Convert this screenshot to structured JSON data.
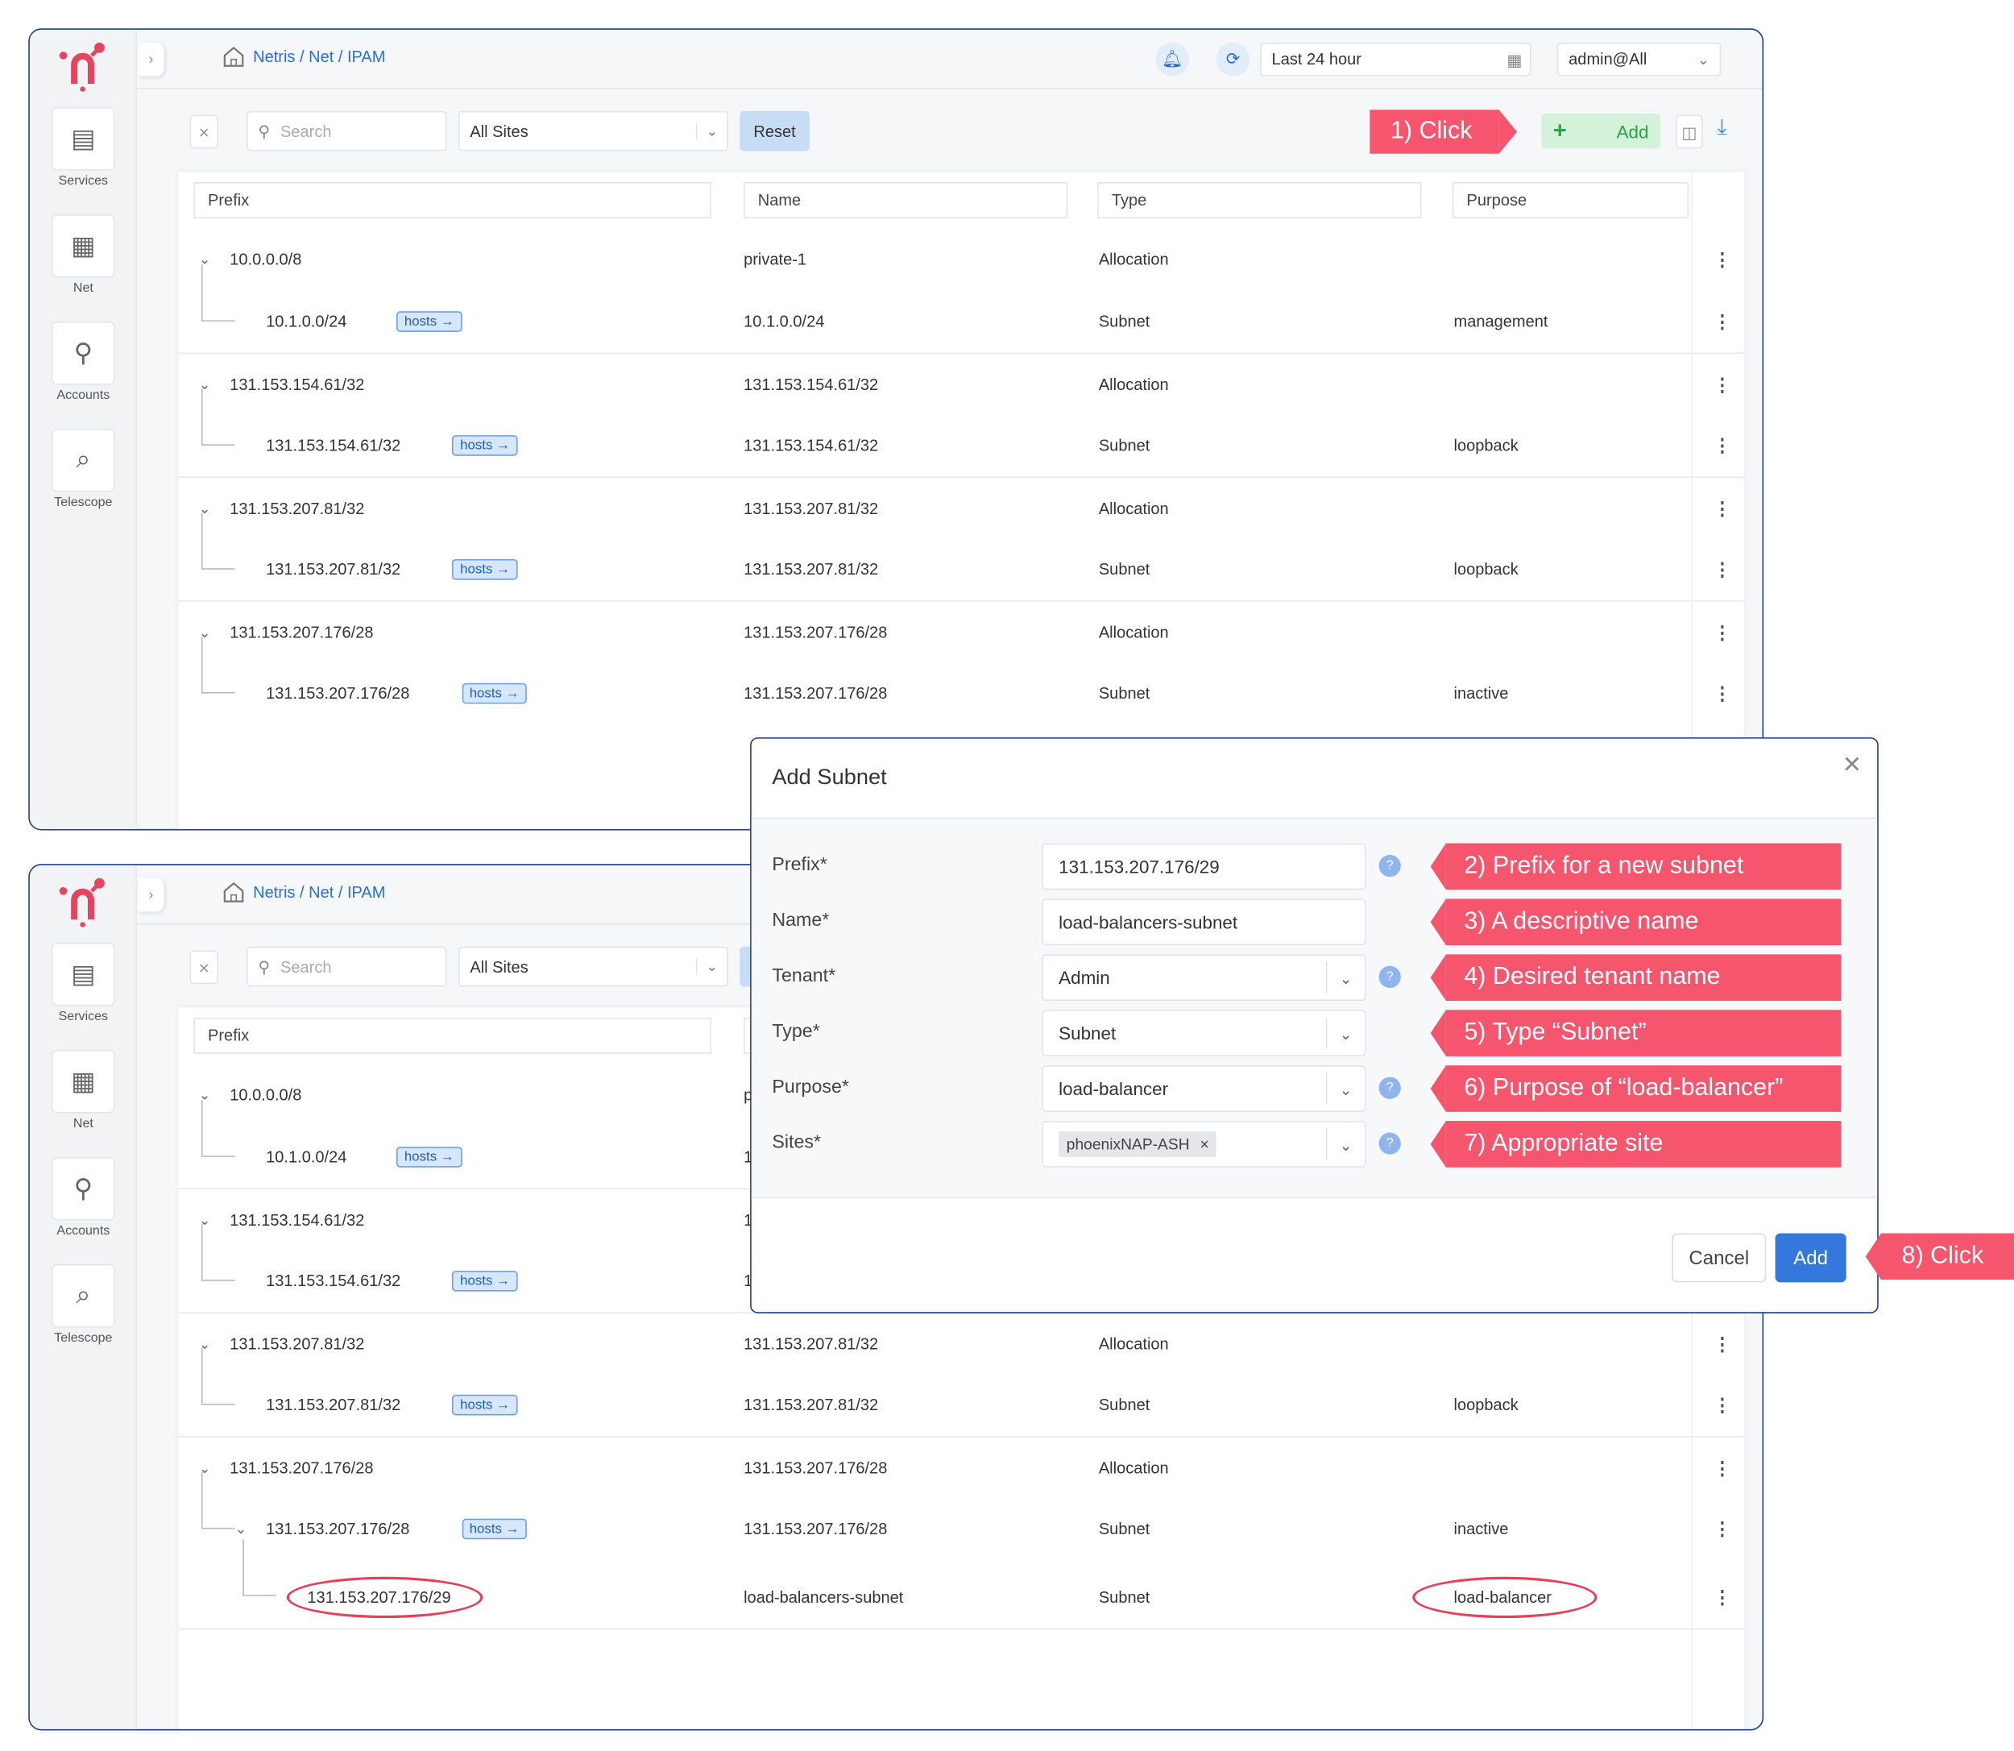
{
  "breadcrumb": "Netris / Net / IPAM",
  "sidebar": [
    "Services",
    "Net",
    "Accounts",
    "Telescope"
  ],
  "header": {
    "time_range": "Last 24 hour",
    "user": "admin@All"
  },
  "toolbar": {
    "search_placeholder": "Search",
    "site_filter": "All Sites",
    "reset": "Reset",
    "add": "Add"
  },
  "annotations": {
    "step1": "1) Click",
    "step2": "2) Prefix for a new subnet",
    "step3": "3) A descriptive name",
    "step4": "4) Desired tenant name",
    "step5": "5) Type “Subnet”",
    "step6": "6) Purpose of “load-balancer”",
    "step7": "7) Appropriate site",
    "step8": "8) Click"
  },
  "columns": [
    "Prefix",
    "Name",
    "Type",
    "Purpose"
  ],
  "rows_before": [
    {
      "level": 0,
      "prefix": "10.0.0.0/8",
      "name": "private-1",
      "type": "Allocation",
      "purpose": ""
    },
    {
      "level": 1,
      "prefix": "10.1.0.0/24",
      "hosts": "hosts",
      "name": "10.1.0.0/24",
      "type": "Subnet",
      "purpose": "management"
    },
    {
      "level": 0,
      "prefix": "131.153.154.61/32",
      "name": "131.153.154.61/32",
      "type": "Allocation",
      "purpose": ""
    },
    {
      "level": 1,
      "prefix": "131.153.154.61/32",
      "hosts": "hosts",
      "name": "131.153.154.61/32",
      "type": "Subnet",
      "purpose": "loopback"
    },
    {
      "level": 0,
      "prefix": "131.153.207.81/32",
      "name": "131.153.207.81/32",
      "type": "Allocation",
      "purpose": ""
    },
    {
      "level": 1,
      "prefix": "131.153.207.81/32",
      "hosts": "hosts",
      "name": "131.153.207.81/32",
      "type": "Subnet",
      "purpose": "loopback"
    },
    {
      "level": 0,
      "prefix": "131.153.207.176/28",
      "name": "131.153.207.176/28",
      "type": "Allocation",
      "purpose": ""
    },
    {
      "level": 1,
      "prefix": "131.153.207.176/28",
      "hosts": "hosts",
      "name": "131.153.207.176/28",
      "type": "Subnet",
      "purpose": "inactive"
    }
  ],
  "rows_after": [
    {
      "level": 0,
      "prefix": "10.0.0.0/8",
      "name": "private-1",
      "type": "Allocation",
      "purpose": ""
    },
    {
      "level": 1,
      "prefix": "10.1.0.0/24",
      "hosts": "hosts",
      "name": "10.1.0.0/24",
      "type": "Subnet",
      "purpose": "management"
    },
    {
      "level": 0,
      "prefix": "131.153.154.61/32",
      "name": "131.153.154.61/32",
      "type": "Allocation",
      "purpose": ""
    },
    {
      "level": 1,
      "prefix": "131.153.154.61/32",
      "hosts": "hosts",
      "name": "131.153.154.61/32",
      "type": "Subnet",
      "purpose": "loopback"
    },
    {
      "level": 0,
      "prefix": "131.153.207.81/32",
      "name": "131.153.207.81/32",
      "type": "Allocation",
      "purpose": ""
    },
    {
      "level": 1,
      "prefix": "131.153.207.81/32",
      "hosts": "hosts",
      "name": "131.153.207.81/32",
      "type": "Subnet",
      "purpose": "loopback"
    },
    {
      "level": 0,
      "prefix": "131.153.207.176/28",
      "name": "131.153.207.176/28",
      "type": "Allocation",
      "purpose": ""
    },
    {
      "level": 1,
      "expanded": true,
      "prefix": "131.153.207.176/28",
      "hosts": "hosts",
      "name": "131.153.207.176/28",
      "type": "Subnet",
      "purpose": "inactive"
    },
    {
      "level": 2,
      "prefix": "131.153.207.176/29",
      "name": "load-balancers-subnet",
      "type": "Subnet",
      "purpose": "load-balancer",
      "highlight": true
    }
  ],
  "modal": {
    "title": "Add Subnet",
    "fields": [
      {
        "label": "Prefix*",
        "value": "131.153.207.176/29"
      },
      {
        "label": "Name*",
        "value": "load-balancers-subnet"
      },
      {
        "label": "Tenant*",
        "value": "Admin"
      },
      {
        "label": "Type*",
        "value": "Subnet"
      },
      {
        "label": "Purpose*",
        "value": "load-balancer"
      },
      {
        "label": "Sites*",
        "value": "phoenixNAP-ASH"
      }
    ],
    "cancel": "Cancel",
    "submit": "Add"
  },
  "colors": {
    "accent": "#2a6fd8",
    "callout": "#f5566e",
    "add_green": "#2ca24a",
    "brand": "#e8435e"
  }
}
